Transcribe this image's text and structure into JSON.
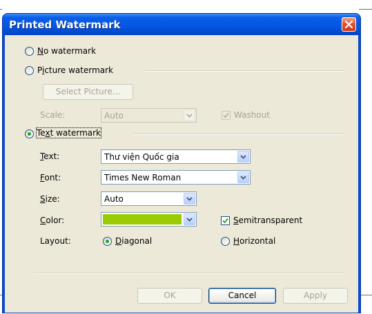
{
  "dialog": {
    "title": "Printed Watermark",
    "close_icon": "close-icon"
  },
  "options": {
    "no_watermark": {
      "label_key": "N",
      "label_rest": "o watermark",
      "selected": false
    },
    "picture_watermark": {
      "label_pre": "P",
      "label_key": "i",
      "label_rest": "cture watermark",
      "selected": false
    },
    "text_watermark": {
      "label_pre": "Te",
      "label_key": "x",
      "label_rest": "t watermark",
      "selected": true
    }
  },
  "picture": {
    "select_button": "Select Picture...",
    "scale_label": "Scale:",
    "scale_value": "Auto",
    "washout_label": "Washout",
    "washout_checked": true
  },
  "text": {
    "text_label_key": "T",
    "text_label_rest": "ext:",
    "text_value": "Thư viện Quốc gia",
    "font_label_key": "F",
    "font_label_rest": "ont:",
    "font_value": "Times New Roman",
    "size_label_key": "S",
    "size_label_rest": "ize:",
    "size_value": "Auto",
    "color_label_key": "C",
    "color_label_rest": "olor:",
    "color_value": "#99cc00",
    "semitransparent_key": "S",
    "semitransparent_rest": "emitransparent",
    "semitransparent_checked": true,
    "layout_label": "Layout:",
    "diagonal_key": "D",
    "diagonal_rest": "iagonal",
    "diagonal_selected": true,
    "horizontal_key": "H",
    "horizontal_rest": "orizontal",
    "horizontal_selected": false
  },
  "buttons": {
    "ok": "OK",
    "cancel": "Cancel",
    "apply": "Apply"
  }
}
